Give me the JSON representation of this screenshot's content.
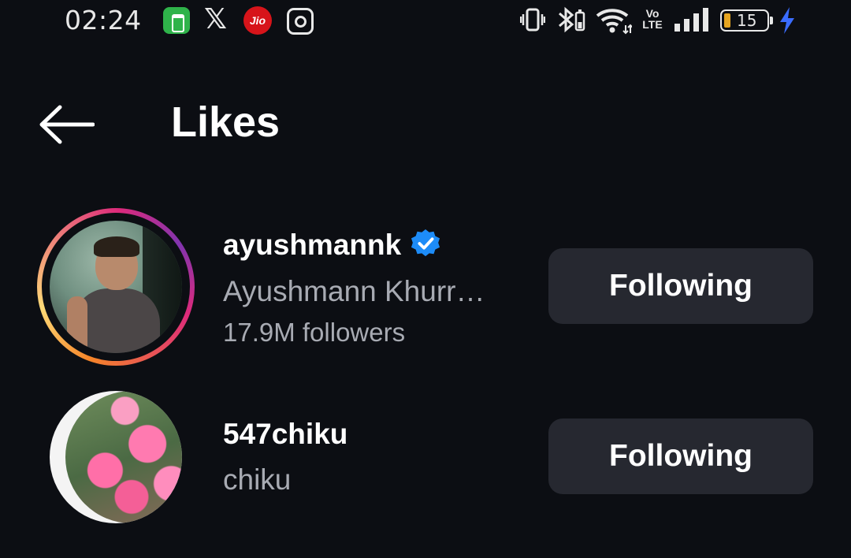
{
  "status_bar": {
    "time": "02:24",
    "apps": [
      "app-green-icon",
      "x-icon",
      "jio-icon",
      "instagram-icon"
    ],
    "jio_label": "Jio",
    "network_label": "Vo LTE",
    "battery_level": "15"
  },
  "header": {
    "title": "Likes"
  },
  "users": [
    {
      "username": "ayushmannk",
      "verified": true,
      "full_name": "Ayushmann Khurr…",
      "followers": "17.9M followers",
      "button_label": "Following",
      "has_story_ring": true
    },
    {
      "username": "547chiku",
      "verified": false,
      "full_name": "chiku",
      "followers": "",
      "button_label": "Following",
      "has_story_ring": false
    }
  ],
  "colors": {
    "background": "#0c0e13",
    "button_bg": "#262830",
    "secondary_text": "#a8abb3",
    "verified_blue": "#1d8cf8"
  }
}
